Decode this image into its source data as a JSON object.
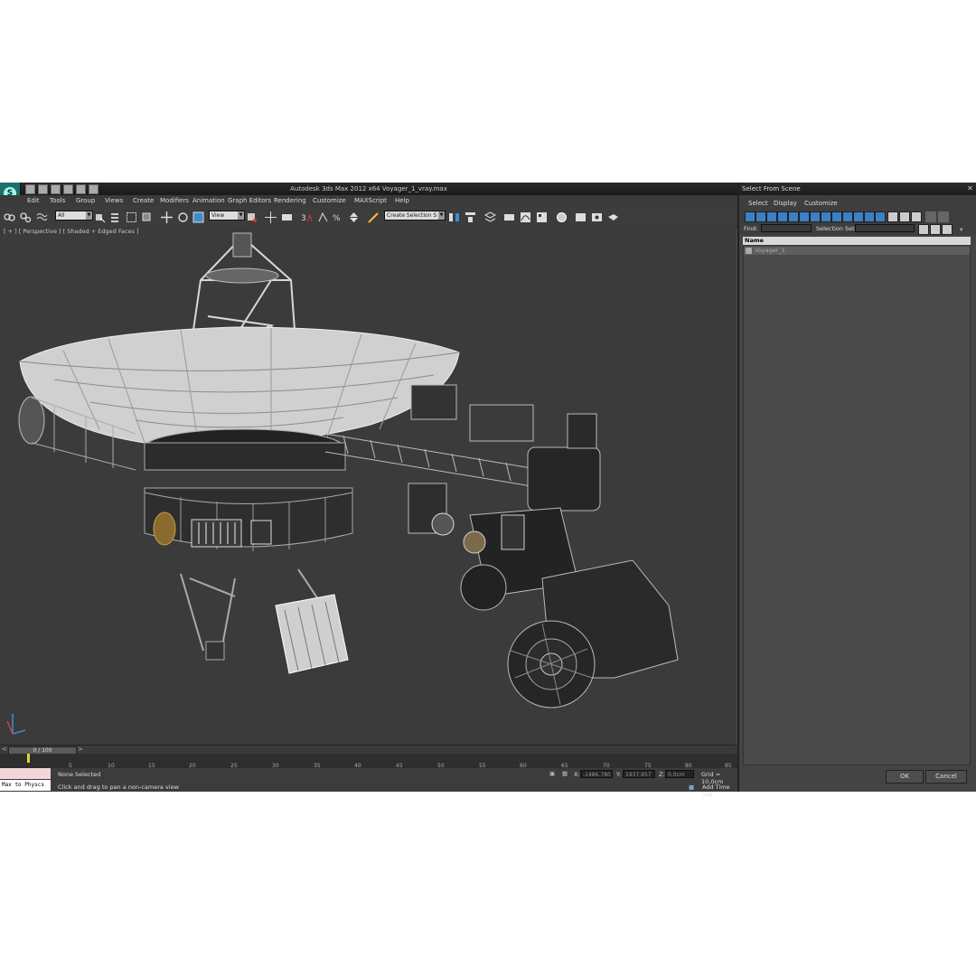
{
  "app": {
    "title": "Autodesk 3ds Max  2012 x64      Voyager_1_vray.max",
    "menu": [
      "Edit",
      "Tools",
      "Group",
      "Views",
      "Create",
      "Modifiers",
      "Animation",
      "Graph Editors",
      "Rendering",
      "Customize",
      "MAXScript",
      "Help"
    ],
    "toolbar": {
      "filter_value": "All",
      "refcoord_value": "View",
      "selection_set_placeholder": "Create Selection S"
    },
    "viewport_label": "[ + ] [ Perspective ] [ Shaded + Edged Faces ]",
    "timeslider": "0 / 100",
    "ruler_ticks": [
      "5",
      "10",
      "15",
      "20",
      "25",
      "30",
      "35",
      "40",
      "45",
      "50",
      "55",
      "60",
      "65",
      "70",
      "75",
      "80",
      "85"
    ],
    "status": {
      "script_text": "Max to Physcs",
      "selection": "None Selected",
      "prompt": "Click and drag to pan a non-camera view",
      "x_label": "X:",
      "x_value": "-1486,780",
      "y_label": "Y:",
      "y_value": "1937,957",
      "z_label": "Z:",
      "z_value": "0,0cm",
      "grid": "Grid = 10,0cm",
      "add_time_tag": "Add Time Tag"
    }
  },
  "dialog": {
    "title": "Select From Scene",
    "menu": [
      "Select",
      "Display",
      "Customize"
    ],
    "find_label": "Find:",
    "selection_set_label": "Selection Set:",
    "column_name": "Name",
    "items": [
      "Voyager_1"
    ],
    "ok": "OK",
    "cancel": "Cancel"
  }
}
